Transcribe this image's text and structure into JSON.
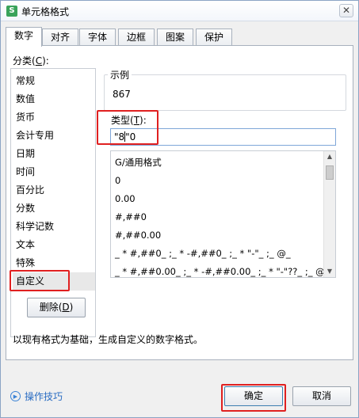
{
  "window": {
    "title": "单元格格式",
    "app_icon": "S"
  },
  "tabs": [
    {
      "label": "数字",
      "active": true
    },
    {
      "label": "对齐"
    },
    {
      "label": "字体"
    },
    {
      "label": "边框"
    },
    {
      "label": "图案"
    },
    {
      "label": "保护"
    }
  ],
  "category": {
    "label_prefix": "分类(",
    "label_key": "C",
    "label_suffix": "):",
    "items": [
      "常规",
      "数值",
      "货币",
      "会计专用",
      "日期",
      "时间",
      "百分比",
      "分数",
      "科学记数",
      "文本",
      "特殊",
      "自定义"
    ],
    "selected": "自定义"
  },
  "sample": {
    "caption": "示例",
    "value": "867"
  },
  "type": {
    "label_prefix": "类型(",
    "label_key": "T",
    "label_suffix": "):",
    "value_before_caret": "\"8",
    "value_after_caret": "\"0"
  },
  "formats": [
    "G/通用格式",
    "0",
    "0.00",
    "#,##0",
    "#,##0.00",
    "_ * #,##0_ ;_ * -#,##0_ ;_ * \"-\"_ ;_ @_",
    "_ * #,##0.00_ ;_ * -#,##0.00_ ;_ * \"-\"??_ ;_ @_"
  ],
  "delete_button": {
    "label_prefix": "删除(",
    "label_key": "D",
    "label_suffix": ")"
  },
  "description": "以现有格式为基础，生成自定义的数字格式。",
  "footer": {
    "tips": "操作技巧",
    "ok": "确定",
    "cancel": "取消"
  },
  "colors": {
    "highlight": "#e02020",
    "link": "#2a6cc2",
    "accent_border": "#7ea6d8"
  }
}
